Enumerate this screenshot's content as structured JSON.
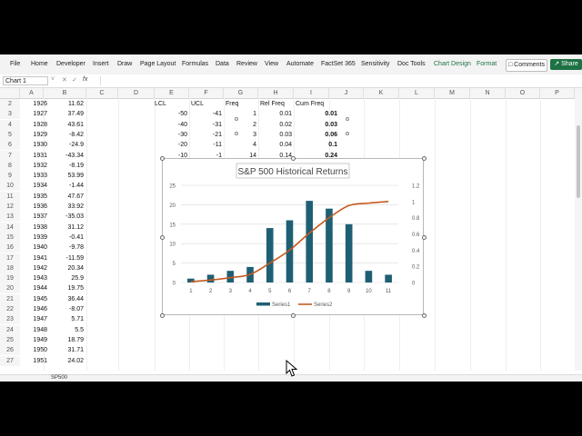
{
  "ribbon": {
    "tabs": [
      "File",
      "Home",
      "Developer",
      "Insert",
      "Draw",
      "Page Layout",
      "Formulas",
      "Data",
      "Review",
      "View",
      "Automate",
      "FactSet 365",
      "Sensitivity",
      "Doc Tools",
      "Chart Design",
      "Format"
    ],
    "active_tabs": [
      "Chart Design",
      "Format"
    ],
    "comments_label": "Comments",
    "share_label": "Share"
  },
  "formula_bar": {
    "name_box": "Chart 1",
    "fx": "fx"
  },
  "columns": [
    "A",
    "B",
    "C",
    "D",
    "E",
    "F",
    "G",
    "H",
    "I",
    "J",
    "K",
    "L",
    "M",
    "N",
    "O",
    "P"
  ],
  "sheet": {
    "rows": [
      {
        "n": "2",
        "a": "1926",
        "b": "11.62"
      },
      {
        "n": "3",
        "a": "1927",
        "b": "37.49"
      },
      {
        "n": "4",
        "a": "1928",
        "b": "43.61"
      },
      {
        "n": "5",
        "a": "1929",
        "b": "-8.42"
      },
      {
        "n": "6",
        "a": "1930",
        "b": "-24.9"
      },
      {
        "n": "7",
        "a": "1931",
        "b": "-43.34"
      },
      {
        "n": "8",
        "a": "1932",
        "b": "-8.19"
      },
      {
        "n": "9",
        "a": "1933",
        "b": "53.99"
      },
      {
        "n": "10",
        "a": "1934",
        "b": "-1.44"
      },
      {
        "n": "11",
        "a": "1935",
        "b": "47.67"
      },
      {
        "n": "12",
        "a": "1936",
        "b": "33.92"
      },
      {
        "n": "13",
        "a": "1937",
        "b": "-35.03"
      },
      {
        "n": "14",
        "a": "1938",
        "b": "31.12"
      },
      {
        "n": "15",
        "a": "1939",
        "b": "-0.41"
      },
      {
        "n": "16",
        "a": "1940",
        "b": "-9.78"
      },
      {
        "n": "17",
        "a": "1941",
        "b": "-11.59"
      },
      {
        "n": "18",
        "a": "1942",
        "b": "20.34"
      },
      {
        "n": "19",
        "a": "1943",
        "b": "25.9"
      },
      {
        "n": "20",
        "a": "1944",
        "b": "19.75"
      },
      {
        "n": "21",
        "a": "1945",
        "b": "36.44"
      },
      {
        "n": "22",
        "a": "1946",
        "b": "-8.07"
      },
      {
        "n": "23",
        "a": "1947",
        "b": "5.71"
      },
      {
        "n": "24",
        "a": "1948",
        "b": "5.5"
      },
      {
        "n": "25",
        "a": "1949",
        "b": "18.79"
      },
      {
        "n": "26",
        "a": "1950",
        "b": "31.71"
      },
      {
        "n": "27",
        "a": "1951",
        "b": "24.02"
      }
    ],
    "freq_headers": [
      "LCL",
      "UCL",
      "Freq",
      "Rel Freq",
      "Cum Freq"
    ],
    "freq_rows": [
      {
        "lcl": "-50",
        "ucl": "-41",
        "freq": "1",
        "rel": "0.01",
        "cum": "0.01"
      },
      {
        "lcl": "-40",
        "ucl": "-31",
        "freq": "2",
        "rel": "0.02",
        "cum": "0.03"
      },
      {
        "lcl": "-30",
        "ucl": "-21",
        "freq": "3",
        "rel": "0.03",
        "cum": "0.06"
      },
      {
        "lcl": "-20",
        "ucl": "-11",
        "freq": "4",
        "rel": "0.04",
        "cum": "0.1"
      },
      {
        "lcl": "-10",
        "ucl": "-1",
        "freq": "14",
        "rel": "0.14",
        "cum": "0.24"
      }
    ],
    "sheet_tab": "SP500"
  },
  "chart_data": {
    "type": "bar",
    "title": "S&P 500 Historical Returns",
    "categories": [
      "1",
      "2",
      "3",
      "4",
      "5",
      "6",
      "7",
      "8",
      "9",
      "10",
      "11"
    ],
    "series": [
      {
        "name": "Series1",
        "type": "bar",
        "axis": "primary",
        "values": [
          1,
          2,
          3,
          4,
          14,
          16,
          21,
          19,
          15,
          3,
          2
        ]
      },
      {
        "name": "Series2",
        "type": "line",
        "axis": "secondary",
        "values": [
          0.01,
          0.03,
          0.06,
          0.1,
          0.24,
          0.4,
          0.61,
          0.8,
          0.95,
          0.98,
          1.0
        ]
      }
    ],
    "primary_ticks": [
      "0",
      "5",
      "10",
      "15",
      "20",
      "25"
    ],
    "secondary_ticks": [
      "0",
      "0.2",
      "0.4",
      "0.6",
      "0.8",
      "1",
      "1.2"
    ],
    "ylim": [
      0,
      25
    ],
    "y2lim": [
      0,
      1.2
    ],
    "legend_position": "bottom",
    "colors": {
      "bar": "#1f5f74",
      "line": "#c55a1e",
      "grid": "#d9d9d9"
    }
  }
}
